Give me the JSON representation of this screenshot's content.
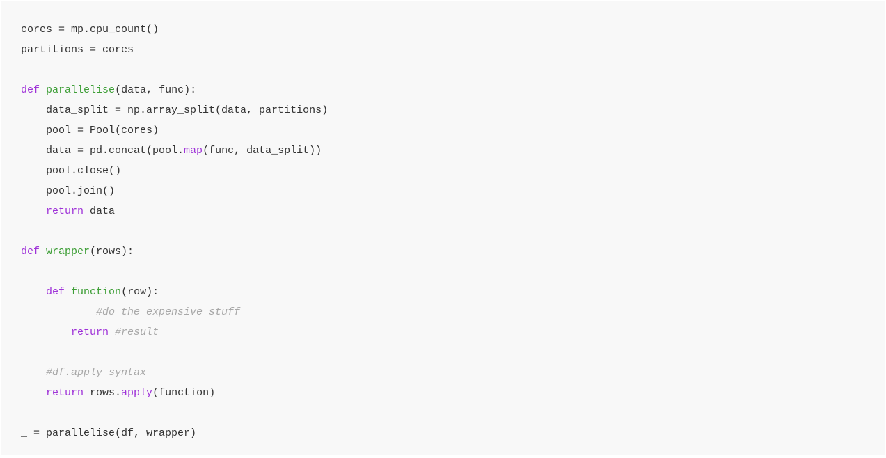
{
  "code": {
    "l1": {
      "t1": "cores = mp.cpu_count()"
    },
    "l2": {
      "t1": "partitions = cores"
    },
    "l3": {
      "t1": ""
    },
    "l4": {
      "kw1": "def",
      "sp1": " ",
      "fn1": "parallelise",
      "t1": "(data, func):"
    },
    "l5": {
      "t1": "    data_split = np.array_split(data, partitions)"
    },
    "l6": {
      "t1": "    pool = Pool(cores)"
    },
    "l7": {
      "t1": "    data = pd.concat(pool.",
      "m1": "map",
      "t2": "(func, data_split))"
    },
    "l8": {
      "t1": "    pool.close()"
    },
    "l9": {
      "t1": "    pool.join()"
    },
    "l10": {
      "t1": "    ",
      "kw1": "return",
      "t2": " data"
    },
    "l11": {
      "t1": ""
    },
    "l12": {
      "kw1": "def",
      "sp1": " ",
      "fn1": "wrapper",
      "t1": "(rows):"
    },
    "l13": {
      "t1": ""
    },
    "l14": {
      "t1": "    ",
      "kw1": "def",
      "sp1": " ",
      "fn1": "function",
      "t2": "(row):"
    },
    "l15": {
      "t1": "            ",
      "c1": "#do the expensive stuff"
    },
    "l16": {
      "t1": "        ",
      "kw1": "return",
      "sp1": " ",
      "c1": "#result"
    },
    "l17": {
      "t1": ""
    },
    "l18": {
      "t1": "    ",
      "c1": "#df.apply syntax"
    },
    "l19": {
      "t1": "    ",
      "kw1": "return",
      "t2": " rows.",
      "m1": "apply",
      "t3": "(function)"
    },
    "l20": {
      "t1": ""
    },
    "l21": {
      "t1": "_ = parallelise(df, wrapper)"
    }
  }
}
